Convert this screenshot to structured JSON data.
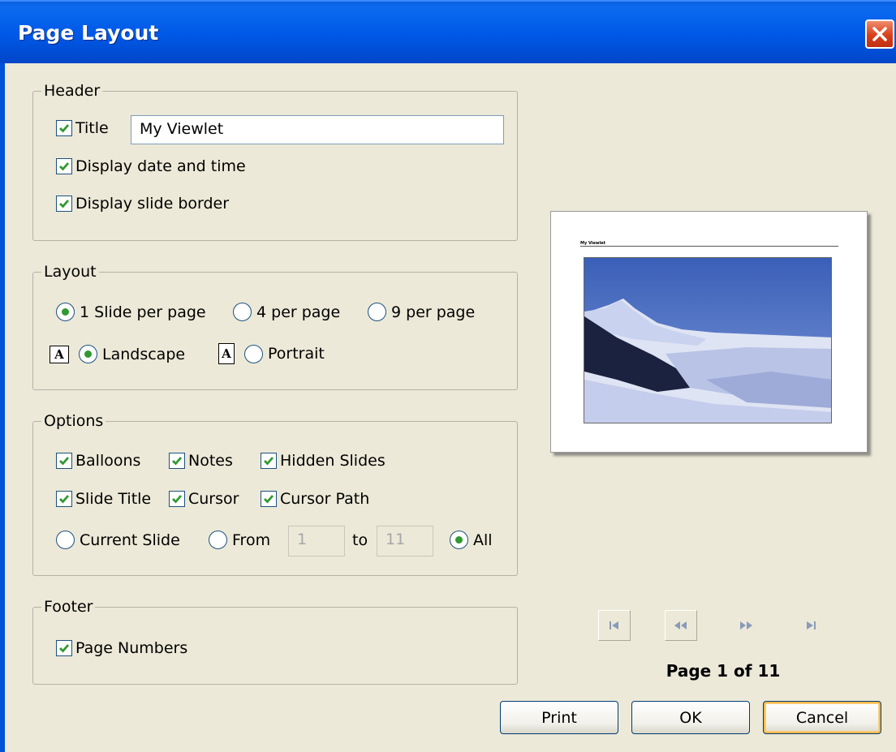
{
  "window": {
    "title": "Page Layout"
  },
  "header": {
    "legend": "Header",
    "title_label": "Title",
    "title_value": "My Viewlet",
    "date_label": "Display date and time",
    "border_label": "Display slide border"
  },
  "layout": {
    "legend": "Layout",
    "per_page": [
      "1 Slide per page",
      "4 per page",
      "9 per page"
    ],
    "per_page_selected": "1 Slide per page",
    "landscape_label": "Landscape",
    "portrait_label": "Portrait",
    "orientation_selected": "Landscape",
    "icon_letter": "A"
  },
  "options": {
    "legend": "Options",
    "balloons": "Balloons",
    "notes": "Notes",
    "hidden_slides": "Hidden Slides",
    "slide_title": "Slide Title",
    "cursor": "Cursor",
    "cursor_path": "Cursor Path",
    "current_slide": "Current Slide",
    "from_label": "From",
    "from_value": "1",
    "to_label": "to",
    "to_value": "11",
    "all_label": "All",
    "range_selected": "All"
  },
  "footer": {
    "legend": "Footer",
    "page_numbers": "Page Numbers"
  },
  "preview": {
    "doc_title": "My Viewlet",
    "page_label": "Page 1 of 11"
  },
  "buttons": {
    "print": "Print",
    "ok": "OK",
    "cancel": "Cancel"
  },
  "colors": {
    "titlebar": "#0058e6",
    "dialog_bg": "#ece9d8",
    "check_green": "#2f9a2f",
    "default_button_ring": "#f7b94b"
  }
}
